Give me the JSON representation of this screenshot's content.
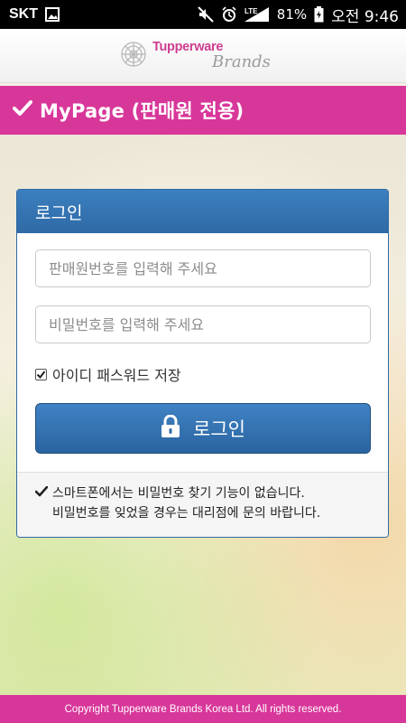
{
  "status_bar": {
    "carrier": "SKT",
    "network": "LTE",
    "battery": "81%",
    "time": "오전 9:46",
    "icons": [
      "image-icon",
      "mute-icon",
      "alarm-icon",
      "signal-icon",
      "battery-icon"
    ]
  },
  "brand": {
    "name": "Tupperware",
    "sub": "Brands",
    "logo_color": "#cf3f8f"
  },
  "title_bar": {
    "icon": "checkmark-icon",
    "title": "MyPage (판매원 전용)",
    "color": "#d8379a"
  },
  "login": {
    "header": "로그인",
    "id_placeholder": "판매원번호를 입력해 주세요",
    "pw_placeholder": "비밀번호를 입력해 주세요",
    "remember_label": "아이디 패스워드 저장",
    "remember_checked": true,
    "button_label": "로그인",
    "button_icon": "lock-icon",
    "accent_color": "#2e6aa6"
  },
  "notice": {
    "line1": "스마트폰에서는 비밀번호 찾기 기능이 없습니다.",
    "line2": "비밀번호를 잊었을 경우는 대리점에 문의 바랍니다."
  },
  "footer": {
    "copyright": "Copyright Tupperware Brands Korea Ltd. All rights reserved."
  }
}
